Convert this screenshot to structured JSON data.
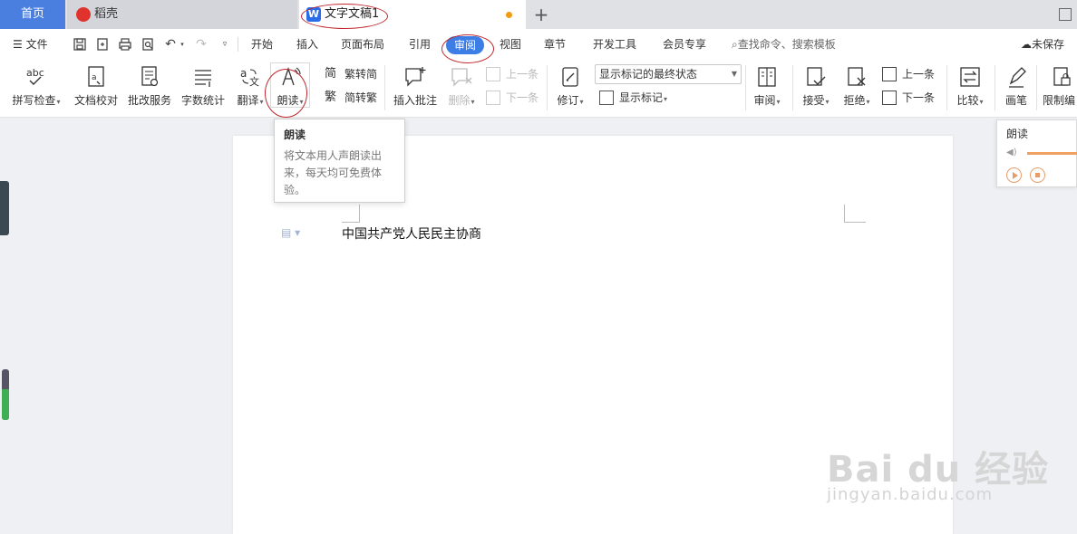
{
  "tabs": {
    "home": "首页",
    "daoke": "稻壳",
    "doc": "文字文稿1",
    "new_tab": "+"
  },
  "menu": {
    "file": "文件",
    "items": [
      "开始",
      "插入",
      "页面布局",
      "引用",
      "审阅",
      "视图",
      "章节",
      "开发工具",
      "会员专享"
    ],
    "active": "审阅",
    "search": "查找命令、搜索模板",
    "save_state": "未保存"
  },
  "ribbon": {
    "spell_check": "拼写检查",
    "doc_proof": "文档校对",
    "revise_service": "批改服务",
    "word_count": "字数统计",
    "translate": "翻译",
    "read_aloud": "朗读",
    "trad_convert": "繁转简",
    "simp_convert": "简转繁",
    "insert_comment": "插入批注",
    "delete": "删除",
    "prev_comment": "上一条",
    "next_comment": "下一条",
    "track_changes": "修订",
    "display_mode": "显示标记的最终状态",
    "show_markup": "显示标记",
    "review": "审阅",
    "accept": "接受",
    "reject": "拒绝",
    "prev_change": "上一条",
    "next_change": "下一条",
    "compare": "比较",
    "pen": "画笔",
    "restrict_edit": "限制编"
  },
  "tooltip": {
    "title": "朗读",
    "body": "将文本用人声朗读出来，每天均可免费体验。"
  },
  "reader_panel": {
    "title": "朗读",
    "volume": 1.0
  },
  "document": {
    "text": "中国共产党人民民主协商"
  },
  "watermark": {
    "main": "Bai du 经验",
    "sub": "jingyan.baidu.com"
  },
  "colors": {
    "accent": "#3d7ee6",
    "home_tab": "#4a7fe0",
    "annotation": "#c0272d",
    "reader_accent": "#e69c6a"
  }
}
